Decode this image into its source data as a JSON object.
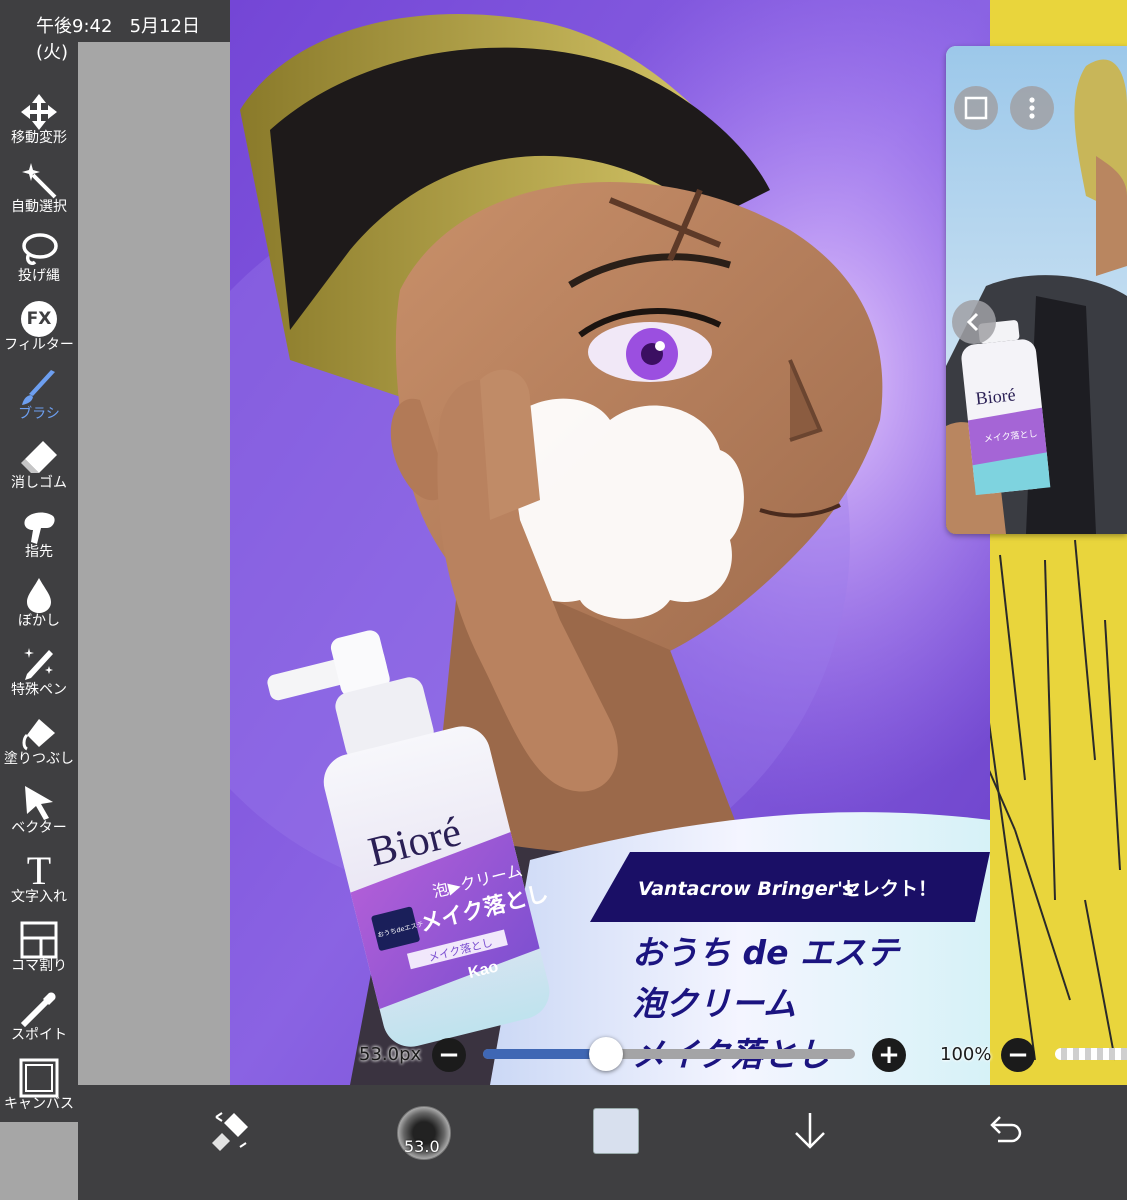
{
  "status_bar": {
    "time": "午後9:42",
    "date": "5月12日 (火)"
  },
  "toolbar": {
    "tools": [
      {
        "label": "移動変形",
        "icon": "move-icon"
      },
      {
        "label": "自動選択",
        "icon": "magic-wand-icon"
      },
      {
        "label": "投げ縄",
        "icon": "lasso-icon"
      },
      {
        "label": "フィルター",
        "icon": "fx-icon"
      },
      {
        "label": "ブラシ",
        "icon": "brush-icon",
        "active": true
      },
      {
        "label": "消しゴム",
        "icon": "eraser-icon"
      },
      {
        "label": "指先",
        "icon": "finger-icon"
      },
      {
        "label": "ぼかし",
        "icon": "blur-drop-icon"
      },
      {
        "label": "特殊ペン",
        "icon": "special-pen-icon"
      },
      {
        "label": "塗りつぶし",
        "icon": "bucket-icon"
      },
      {
        "label": "ベクター",
        "icon": "vector-arrow-icon"
      },
      {
        "label": "文字入れ",
        "icon": "text-icon"
      },
      {
        "label": "コマ割り",
        "icon": "frame-divide-icon"
      },
      {
        "label": "スポイト",
        "icon": "eyedropper-icon"
      },
      {
        "label": "キャンバス",
        "icon": "canvas-icon"
      }
    ],
    "fx_text": "FX",
    "text_tool_glyph": "T"
  },
  "artwork": {
    "banner_en": "Vantacrow Bringer's",
    "banner_jp": "セレクト！",
    "headline_1": "おうち de エステ",
    "headline_2": "泡クリーム",
    "headline_3": "メイク落とし",
    "bottle_brand": "Bioré",
    "bottle_line1": "泡▶クリーム",
    "bottle_line2": "メイク落とし",
    "bottle_badge": "おうちdeエステ",
    "bottle_sub": "メイク落とし",
    "bottle_maker": "Kao",
    "ref_bottle_brand": "Bioré",
    "ref_bottle_line": "メイク落とし",
    "colors": {
      "bg_purple": "#7a52d8",
      "banner_navy": "#1a0f66",
      "headline_navy": "#1b1480",
      "yellow": "#e9d53c"
    }
  },
  "brush_slider": {
    "size_label": "53.0px",
    "minus": "−",
    "plus": "+",
    "value_fraction": 0.33
  },
  "opacity_slider": {
    "label": "100%",
    "minus": "−"
  },
  "bottom_bar": {
    "brush_preview_size": "53.0",
    "items": [
      "swap-icon",
      "brush-preview",
      "color-swatch",
      "layer-down-icon",
      "undo-icon"
    ],
    "color": "#d8e0ee"
  }
}
